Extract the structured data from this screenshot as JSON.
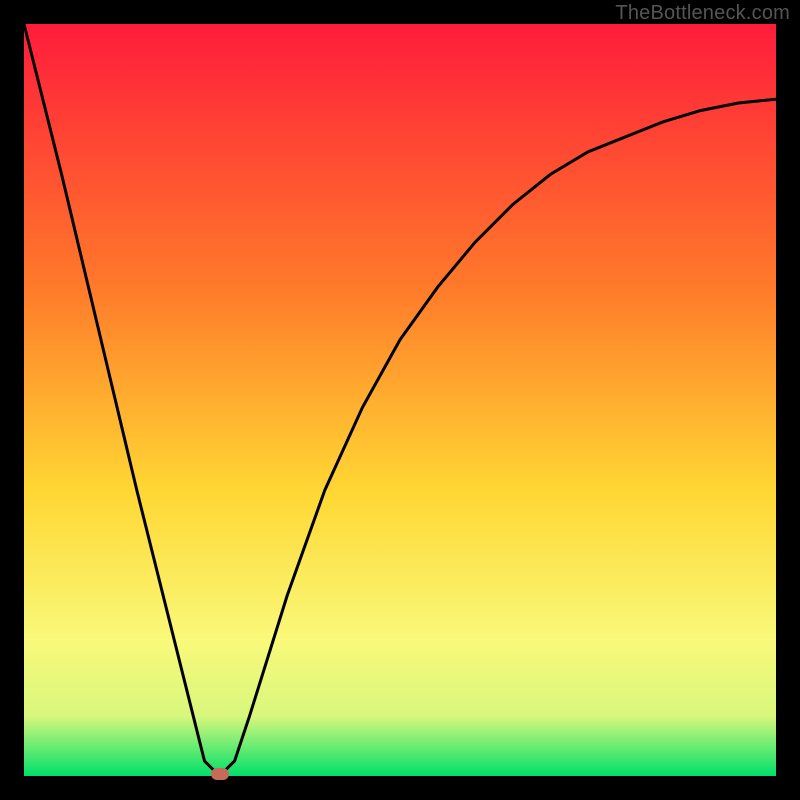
{
  "watermark": "TheBottleneck.com",
  "colors": {
    "frame": "#000000",
    "gradient_top": "#ff1c3b",
    "gradient_mid1": "#ff7a2a",
    "gradient_mid2": "#ffd733",
    "gradient_mid3": "#f9f97a",
    "gradient_mid4": "#d8f77c",
    "gradient_bottom": "#00e06a",
    "curve": "#000000",
    "marker": "#c66b5a"
  },
  "chart_data": {
    "type": "line",
    "title": "",
    "xlabel": "",
    "ylabel": "",
    "xlim": [
      0,
      100
    ],
    "ylim": [
      0,
      100
    ],
    "grid": false,
    "legend": false,
    "series": [
      {
        "name": "bottleneck-curve",
        "x": [
          0,
          5,
          10,
          15,
          20,
          24,
          26,
          28,
          30,
          35,
          40,
          45,
          50,
          55,
          60,
          65,
          70,
          75,
          80,
          85,
          90,
          95,
          100
        ],
        "values": [
          100,
          80,
          59,
          38,
          18,
          2,
          0,
          2,
          8,
          24,
          38,
          49,
          58,
          65,
          71,
          76,
          80,
          83,
          85,
          87,
          88.5,
          89.5,
          90
        ]
      }
    ],
    "marker": {
      "x": 26,
      "y": 0
    },
    "background_gradient": {
      "direction": "vertical",
      "stops": [
        {
          "pos": 0.0,
          "color": "#ff1c3b"
        },
        {
          "pos": 0.35,
          "color": "#ff7a2a"
        },
        {
          "pos": 0.62,
          "color": "#ffd733"
        },
        {
          "pos": 0.82,
          "color": "#f9f97a"
        },
        {
          "pos": 0.92,
          "color": "#d8f77c"
        },
        {
          "pos": 1.0,
          "color": "#00e06a"
        }
      ]
    }
  }
}
